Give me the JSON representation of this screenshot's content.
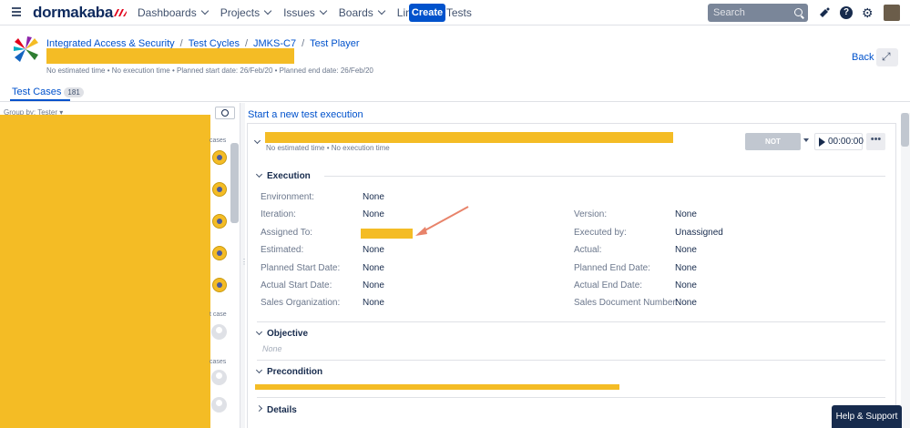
{
  "nav": {
    "logo": "dormakaba",
    "items": [
      "Dashboards",
      "Projects",
      "Issues",
      "Boards",
      "Links",
      "Tests"
    ],
    "create_label": "Create",
    "search_placeholder": "Search"
  },
  "header": {
    "breadcrumb": [
      "Integrated Access & Security",
      "Test Cycles",
      "JMKS-C7",
      "Test Player"
    ],
    "meta": "No estimated time  •  No execution time  •  Planned start date: 26/Feb/20  •  Planned end date: 26/Feb/20",
    "back_label": "Back"
  },
  "tabs": {
    "test_cases_label": "Test Cases",
    "test_cases_count": "181"
  },
  "left_panel": {
    "group_by": "Group by: Tester",
    "labels": [
      "cases",
      "t case",
      "cases"
    ]
  },
  "main": {
    "new_execution_link": "Start a new test execution",
    "card_meta": "No estimated time  •  No execution time",
    "status_button": "NOT EXECUTED",
    "timer": "00:00:00",
    "more_label": "•••",
    "sections": {
      "execution": "Execution",
      "objective": "Objective",
      "objective_placeholder": "None",
      "precondition": "Precondition",
      "details": "Details"
    },
    "fields_left": [
      {
        "label": "Environment:",
        "value": "None"
      },
      {
        "label": "Iteration:",
        "value": "None"
      },
      {
        "label": "Assigned To:",
        "value": ""
      },
      {
        "label": "Estimated:",
        "value": "None"
      },
      {
        "label": "Planned Start Date:",
        "value": "None"
      },
      {
        "label": "Actual Start Date:",
        "value": "None"
      },
      {
        "label": "Sales Organization:",
        "value": "None"
      }
    ],
    "fields_right": [
      {
        "label": "Version:",
        "value": "None"
      },
      {
        "label": "Executed by:",
        "value": "Unassigned"
      },
      {
        "label": "Actual:",
        "value": "None"
      },
      {
        "label": "Planned End Date:",
        "value": "None"
      },
      {
        "label": "Actual End Date:",
        "value": "None"
      },
      {
        "label": "Sales Document Number:",
        "value": "None"
      }
    ]
  },
  "help": {
    "label": "Help & Support"
  },
  "colors": {
    "accent": "#0052cc",
    "redaction": "#f4bc25",
    "nav_dark": "#172b4d"
  }
}
